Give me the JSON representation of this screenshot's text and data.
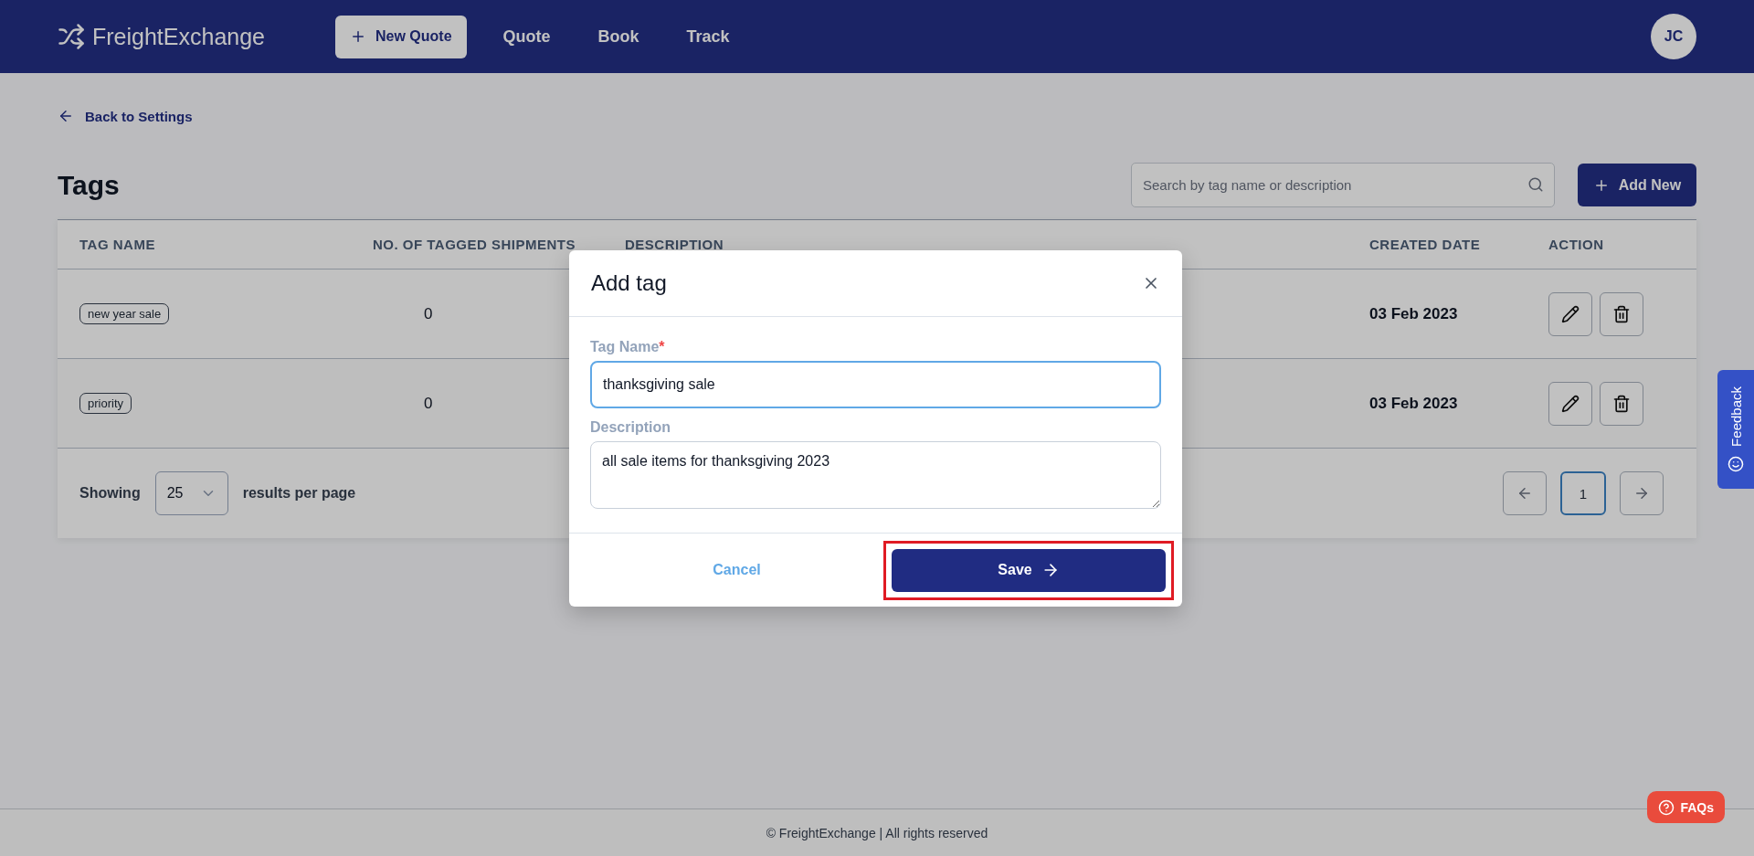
{
  "header": {
    "logo": "FreightExchange",
    "new_quote": "New Quote",
    "nav": [
      {
        "label": "Quote"
      },
      {
        "label": "Book"
      },
      {
        "label": "Track"
      }
    ],
    "avatar": "JC"
  },
  "back_link": "Back to Settings",
  "page_title": "Tags",
  "search": {
    "placeholder": "Search by tag name or description"
  },
  "add_button": "Add New",
  "table": {
    "columns": [
      "TAG NAME",
      "NO. OF TAGGED SHIPMENTS",
      "DESCRIPTION",
      "CREATED DATE",
      "ACTION"
    ],
    "rows": [
      {
        "tag": "new year sale",
        "shipments": "0",
        "created": "03 Feb 2023"
      },
      {
        "tag": "priority",
        "shipments": "0",
        "created": "03 Feb 2023"
      }
    ]
  },
  "pagination": {
    "showing": "Showing",
    "page_size": "25",
    "per_page": "results per page",
    "pages": [
      {
        "label": "1",
        "selected": true
      }
    ]
  },
  "modal": {
    "title": "Add tag",
    "fields": [
      {
        "kind": "input",
        "label": "Tag Name",
        "required": true,
        "value": "thanksgiving sale",
        "focused": true
      },
      {
        "kind": "textarea",
        "label": "Description",
        "required": false,
        "value": "all sale items for thanksgiving 2023",
        "focused": false
      }
    ],
    "required_mark": "*",
    "cancel": "Cancel",
    "save": {
      "label": "Save",
      "highlighted": true
    }
  },
  "feedback_tab": "Feedback",
  "faq_button": "FAQs",
  "footer": "© FreightExchange | All rights reserved"
}
